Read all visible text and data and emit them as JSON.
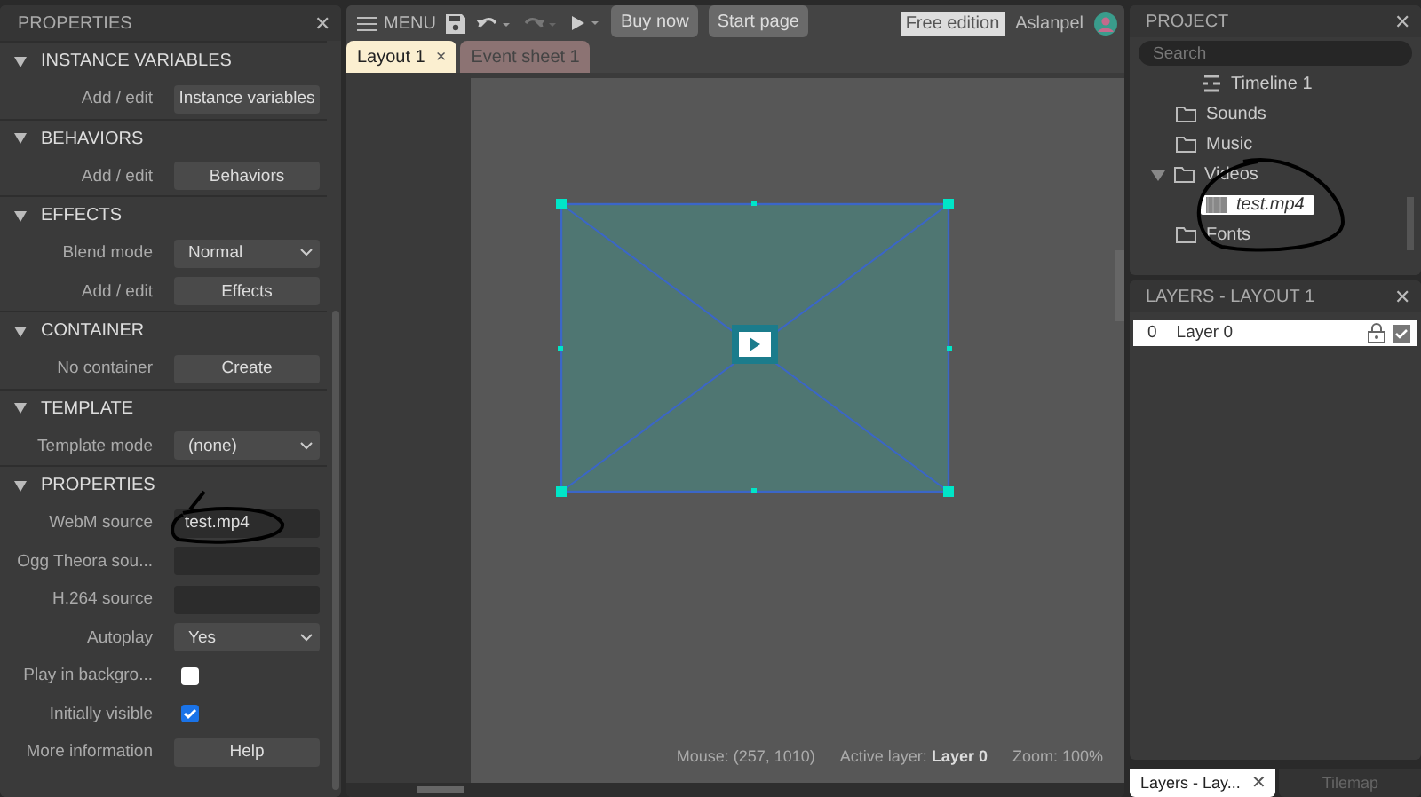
{
  "properties_panel": {
    "title": "PROPERTIES",
    "close_icon": "✕",
    "sections": [
      {
        "title": "INSTANCE VARIABLES",
        "expanded": true,
        "rows": [
          {
            "kind": "button",
            "label": "Add / edit",
            "value": "Instance variables"
          }
        ]
      },
      {
        "title": "BEHAVIORS",
        "expanded": true,
        "rows": [
          {
            "kind": "button",
            "label": "Add / edit",
            "value": "Behaviors"
          }
        ]
      },
      {
        "title": "EFFECTS",
        "expanded": true,
        "rows": [
          {
            "kind": "select",
            "label": "Blend mode",
            "value": "Normal"
          },
          {
            "kind": "button",
            "label": "Add / edit",
            "value": "Effects"
          }
        ]
      },
      {
        "title": "CONTAINER",
        "expanded": true,
        "rows": [
          {
            "kind": "button",
            "label": "No container",
            "value": "Create"
          }
        ]
      },
      {
        "title": "TEMPLATE",
        "expanded": true,
        "rows": [
          {
            "kind": "select",
            "label": "Template mode",
            "value": "(none)"
          }
        ]
      },
      {
        "title": "PROPERTIES",
        "expanded": true,
        "rows": [
          {
            "kind": "text",
            "label": "WebM source",
            "value": "test.mp4"
          },
          {
            "kind": "text",
            "label": "Ogg Theora sou..."
          },
          {
            "kind": "text",
            "label": "H.264 source"
          },
          {
            "kind": "select",
            "label": "Autoplay",
            "value": "Yes"
          },
          {
            "kind": "checkbox",
            "label": "Play in backgro...",
            "checked": false
          },
          {
            "kind": "checkbox",
            "label": "Initially visible",
            "checked": true
          },
          {
            "kind": "button",
            "label": "More information",
            "value": "Help"
          }
        ]
      }
    ]
  },
  "toolbar": {
    "menu": "MENU",
    "buttons": [
      "Buy now",
      "Start page"
    ],
    "edition": "Free edition",
    "user": "Aslanpel"
  },
  "tabs": [
    {
      "label": "Layout 1",
      "selected": true,
      "close_icon": "×"
    },
    {
      "label": "Event sheet 1",
      "selected": false
    }
  ],
  "status": {
    "mouse": "Mouse: (257, 1010)",
    "active_layer": "Active layer: **Layer 0**",
    "zoom": "Zoom: 100%"
  },
  "project_panel": {
    "title": "PROJECT",
    "close_icon": "✕",
    "search": {
      "placeholder": "Search"
    },
    "items": [
      {
        "kind": "timeline",
        "label": "Timeline 1",
        "selected": false
      },
      {
        "kind": "folder",
        "label": "Sounds",
        "selected": false
      },
      {
        "kind": "folder",
        "label": "Music",
        "selected": false
      },
      {
        "kind": "folder",
        "label": "Videos",
        "selected": false,
        "expanded": true,
        "children": [
          {
            "kind": "video",
            "label": "test.mp4",
            "selected": true
          }
        ]
      },
      {
        "kind": "folder",
        "label": "Fonts",
        "selected": false
      }
    ]
  },
  "layers_panel": {
    "title": "LAYERS - LAYOUT 1",
    "close_icon": "✕",
    "layers": [
      {
        "index": "0",
        "name": "Layer 0",
        "visible": true
      }
    ]
  },
  "bottom_tabs": [
    {
      "label": "Layers - Lay...",
      "selected": true,
      "close_icon": "✕"
    },
    {
      "label": "Tilemap",
      "selected": false
    }
  ]
}
